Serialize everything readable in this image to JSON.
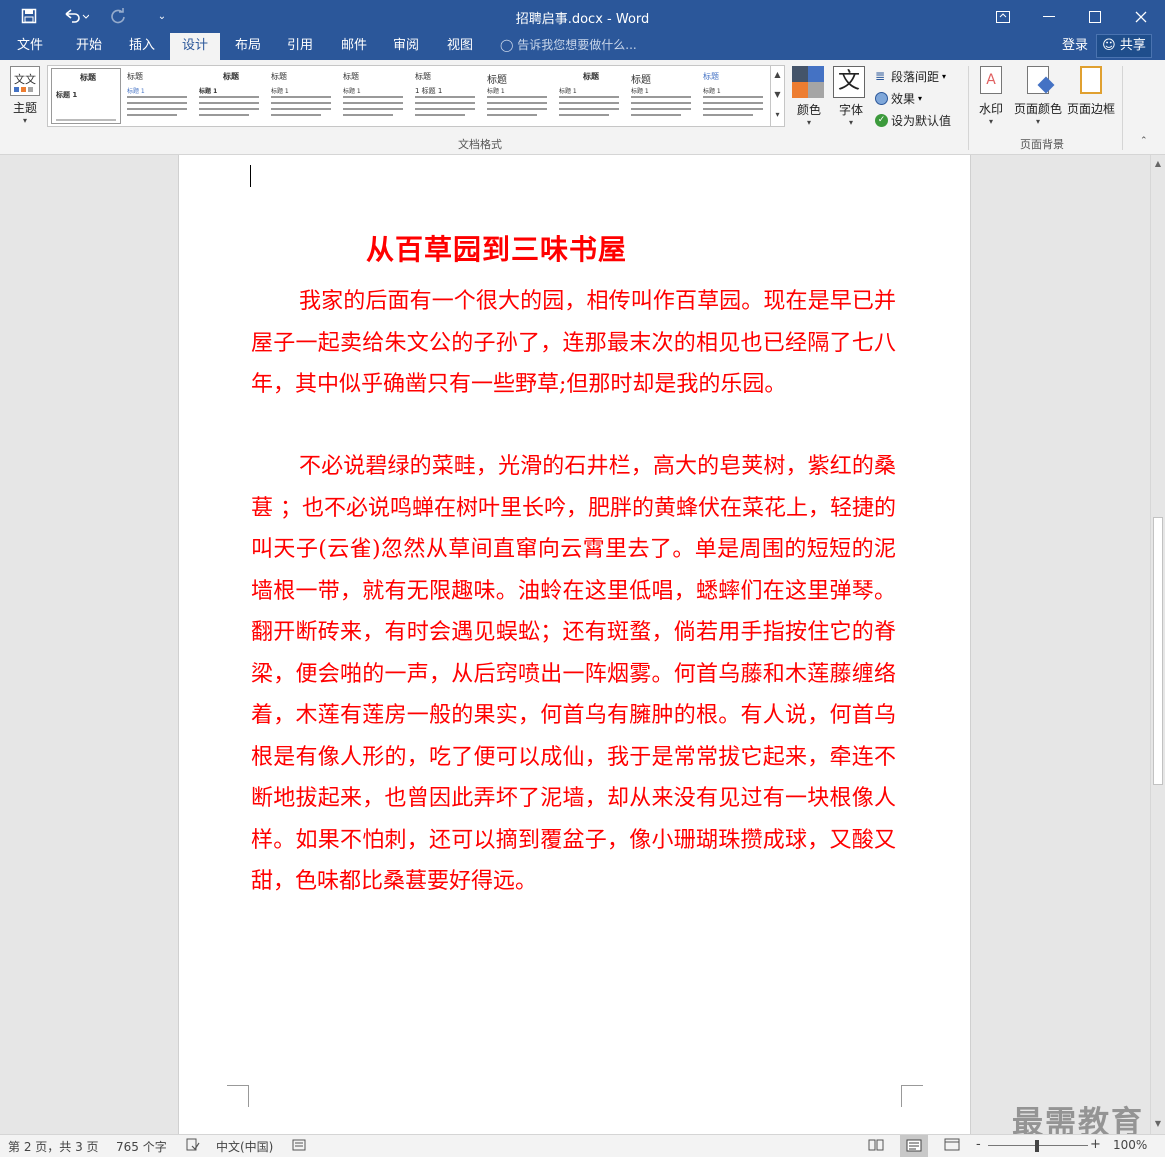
{
  "window": {
    "title": "招聘启事.docx - Word"
  },
  "quick_access": {
    "save_icon": "save-icon",
    "undo_icon": "undo-icon",
    "redo_icon": "redo-icon",
    "customize_icon": "customize-qat-icon"
  },
  "tabs": [
    "文件",
    "开始",
    "插入",
    "设计",
    "布局",
    "引用",
    "邮件",
    "审阅",
    "视图"
  ],
  "active_tab": "设计",
  "tell_me": "告诉我您想要做什么...",
  "account": {
    "login": "登录",
    "share": "共享"
  },
  "ribbon": {
    "theme_label": "主题",
    "gallery": [
      {
        "heading": "标题",
        "sub": "标题 1"
      },
      {
        "heading": "标题",
        "sub": "标题 1"
      },
      {
        "heading": "标题",
        "sub": "标题 1"
      },
      {
        "heading": "标题",
        "sub": "标题 1"
      },
      {
        "heading": "标题",
        "sub": "标题 1"
      },
      {
        "heading": "标题",
        "sub": "1 标题 1"
      },
      {
        "heading": "标题",
        "sub": "标题 1"
      },
      {
        "heading": "标题",
        "sub": "标题 1"
      },
      {
        "heading": "标题",
        "sub": "标题 1"
      },
      {
        "heading": "标题",
        "sub": "标题 1"
      }
    ],
    "doc_format_label": "文档格式",
    "colors_label": "颜色",
    "fonts_label": "字体",
    "fonts_glyph": "文",
    "paragraph_spacing": "段落间距",
    "effects": "效果",
    "set_default": "设为默认值",
    "watermark_label": "水印",
    "page_color_label": "页面颜色",
    "page_border_label": "页面边框",
    "page_background_label": "页面背景"
  },
  "document": {
    "heading": "从百草园到三味书屋",
    "paragraphs": [
      "我家的后面有一个很大的园，相传叫作百草园。现在是早已并屋子一起卖给朱文公的子孙了，连那最末次的相见也已经隔了七八年，其中似乎确凿只有一些野草;但那时却是我的乐园。",
      "不必说碧绿的菜畦，光滑的石井栏，高大的皂荚树，紫红的桑葚 ；也不必说鸣蝉在树叶里长吟，肥胖的黄蜂伏在菜花上，轻捷的叫天子(云雀)忽然从草间直窜向云霄里去了。单是周围的短短的泥墙根一带，就有无限趣味。油蛉在这里低唱，蟋蟀们在这里弹琴。翻开断砖来，有时会遇见蜈蚣；还有斑蝥，倘若用手指按住它的脊梁，便会啪的一声，从后窍喷出一阵烟雾。何首乌藤和木莲藤缠络着，木莲有莲房一般的果实，何首乌有臃肿的根。有人说，何首乌根是有像人形的，吃了便可以成仙，我于是常常拔它起来，牵连不断地拔起来，也曾因此弄坏了泥墙，却从来没有见过有一块根像人样。如果不怕刺，还可以摘到覆盆子，像小珊瑚珠攒成球，又酸又甜，色味都比桑葚要好得远。"
    ],
    "text_color": "#ff0000"
  },
  "status": {
    "page": "第 2 页，共 3 页",
    "words": "765 个字",
    "language": "中文(中国)",
    "zoom": "100%",
    "zoom_minus": "-",
    "zoom_plus": "+"
  },
  "watermark_logo": "最需教育",
  "colors": {
    "title_bar": "#2b579a",
    "ribbon": "#f3f3f3",
    "doc_text": "#ff0000"
  }
}
